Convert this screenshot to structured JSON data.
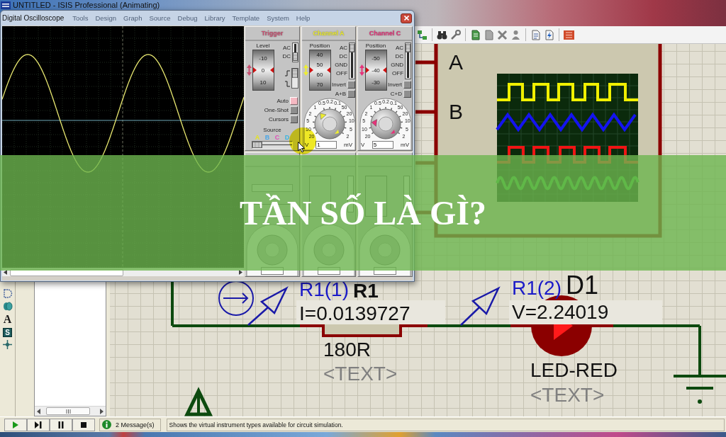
{
  "main_window": {
    "title": "UNTITLED - ISIS Professional (Animating)",
    "menu": [
      "Tools",
      "Design",
      "Graph",
      "Source",
      "Debug",
      "Library",
      "Template",
      "System",
      "Help"
    ]
  },
  "left_toolbar": [
    {
      "kind": "arc"
    },
    {
      "kind": "circles"
    },
    {
      "kind": "text",
      "glyph": "A"
    },
    {
      "kind": "symbol",
      "glyph": "S"
    },
    {
      "kind": "marker"
    }
  ],
  "oscilloscope": {
    "title": "Digital Oscilloscope",
    "panels": [
      {
        "kind": "trigger",
        "title": "Trigger",
        "color": "#c85070",
        "level_label": "Level",
        "drum": [
          "-10",
          "0",
          "10"
        ],
        "coupling": [
          {
            "label": "AC",
            "selected": false
          },
          {
            "label": "DC",
            "selected": true
          }
        ],
        "rising_edge": true,
        "buttons": [
          {
            "label": "Auto",
            "on": true
          },
          {
            "label": "One-Shot",
            "on": false
          },
          {
            "label": "Cursors",
            "on": false
          }
        ],
        "source_label": "Source",
        "sources": [
          {
            "label": "A",
            "color": "#e4e420",
            "selected": true
          },
          {
            "label": "B",
            "color": "#4aa6e6",
            "selected": false
          },
          {
            "label": "C",
            "color": "#e050b8",
            "selected": false
          },
          {
            "label": "D",
            "color": "#3ab4e0",
            "selected": false
          }
        ]
      },
      {
        "kind": "channel",
        "title": "Channel A",
        "color": "#eeee30",
        "position_label": "Position",
        "drum": [
          "40",
          "50",
          "60",
          "70"
        ],
        "coupling": [
          {
            "label": "AC",
            "selected": true
          },
          {
            "label": "DC",
            "selected": false
          },
          {
            "label": "GND",
            "selected": false
          },
          {
            "label": "OFF",
            "selected": false
          }
        ],
        "buttons": [
          {
            "label": "Invert",
            "on": false
          },
          {
            "label": "A+B",
            "on": false
          }
        ],
        "dial": {
          "left": [
            {
              "label": "1",
              "selected": true
            },
            {
              "label": "2",
              "selected": false
            },
            {
              "label": "5",
              "selected": false
            },
            {
              "label": "10",
              "selected": false
            },
            {
              "label": "20",
              "selected": false
            }
          ],
          "top": [
            {
              "label": "0.5",
              "selected": false
            },
            {
              "label": "0.2",
              "selected": false
            },
            {
              "label": "0.1",
              "selected": false
            }
          ],
          "right": [
            {
              "label": "50",
              "selected": false
            },
            {
              "label": "20",
              "selected": false
            },
            {
              "label": "10",
              "selected": false
            },
            {
              "label": "5",
              "selected": false
            },
            {
              "label": "2",
              "selected": false
            }
          ]
        },
        "unit_left": "V",
        "value": "1",
        "unit_right": "mV"
      },
      {
        "kind": "channel",
        "title": "Channel C",
        "color": "#e63279",
        "position_label": "Position",
        "drum": [
          "-50",
          "-40",
          "-30"
        ],
        "coupling": [
          {
            "label": "AC",
            "selected": true
          },
          {
            "label": "DC",
            "selected": false
          },
          {
            "label": "GND",
            "selected": false
          },
          {
            "label": "OFF",
            "selected": false
          }
        ],
        "buttons": [
          {
            "label": "Invert",
            "on": false
          },
          {
            "label": "C+D",
            "on": false
          }
        ],
        "dial": {
          "left": [
            {
              "label": "1",
              "selected": false
            },
            {
              "label": "2",
              "selected": false
            },
            {
              "label": "5",
              "selected": true
            },
            {
              "label": "10",
              "selected": false
            },
            {
              "label": "20",
              "selected": false
            }
          ],
          "top": [
            {
              "label": "0.5",
              "selected": false
            },
            {
              "label": "0.2",
              "selected": false
            },
            {
              "label": "0.1",
              "selected": false
            }
          ],
          "right": [
            {
              "label": "50",
              "selected": false
            },
            {
              "label": "20",
              "selected": false
            },
            {
              "label": "10",
              "selected": false
            },
            {
              "label": "5",
              "selected": false
            },
            {
              "label": "2",
              "selected": false
            }
          ]
        },
        "unit_left": "V",
        "value": "5",
        "unit_right": "mV"
      },
      {
        "kind": "timebase"
      },
      {
        "kind": "lowerchannel"
      },
      {
        "kind": "lowerchannel"
      }
    ]
  },
  "schematic": {
    "instrument_pins": [
      "A",
      "B"
    ],
    "probes": [
      {
        "kind": "current",
        "label": "R1(1)",
        "reading": "I=0.0139727"
      },
      {
        "kind": "voltage",
        "label": "R1(2)",
        "reading": "V=2.24019"
      }
    ],
    "components": [
      {
        "kind": "resistor",
        "ref": "R1",
        "value": "180R",
        "text": "<TEXT>"
      },
      {
        "kind": "led",
        "ref": "D1",
        "value": "LED-RED",
        "text": "<TEXT>"
      }
    ]
  },
  "status_bar": {
    "sim_controls": [
      {
        "kind": "play"
      },
      {
        "kind": "step"
      },
      {
        "kind": "pause"
      },
      {
        "kind": "stop"
      }
    ],
    "messages": "2 Message(s)",
    "hint": "Shows the virtual instrument types available for circuit simulation."
  },
  "banner": {
    "title": "TẦN SỐ LÀ GÌ?"
  }
}
